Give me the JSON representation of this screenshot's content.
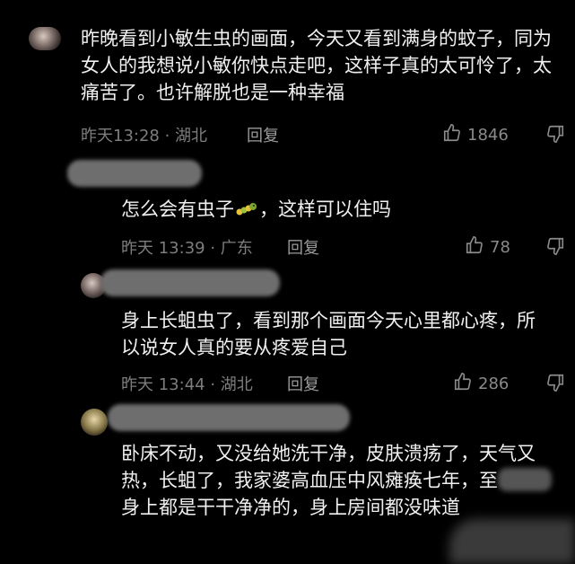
{
  "comments": [
    {
      "text": "昨晚看到小敏生虫的画面，今天又看到满身的蚊子，同为女人的我想说小敏你快点走吧，这样子真的太可怜了，太痛苦了。也许解脱也是一种幸福",
      "time_location": "昨天13:28 · 湖北",
      "reply_label": "回复",
      "likes": "1846"
    },
    {
      "text_before": "怎么会有虫子",
      "emoji": "caterpillar",
      "text_after": "，这样可以住吗",
      "time_location": "昨天 13:39 · 广东",
      "reply_label": "回复",
      "likes": "78"
    },
    {
      "text": "身上长蛆虫了，看到那个画面今天心里都心疼，所以说女人真的要从疼爱自己",
      "time_location": "昨天 13:44 · 湖北",
      "reply_label": "回复",
      "likes": "286"
    },
    {
      "text_part1": "卧床不动，又没给她洗干净，皮肤溃疡了，天气又热，长蛆了，我家婆高血压中风瘫痪七年，至",
      "text_part2": "身上都是干干净净的，身上房间都没味道"
    }
  ],
  "colors": {
    "background": "#000000",
    "text": "#f0f0f0",
    "meta": "#7d7d7d"
  }
}
